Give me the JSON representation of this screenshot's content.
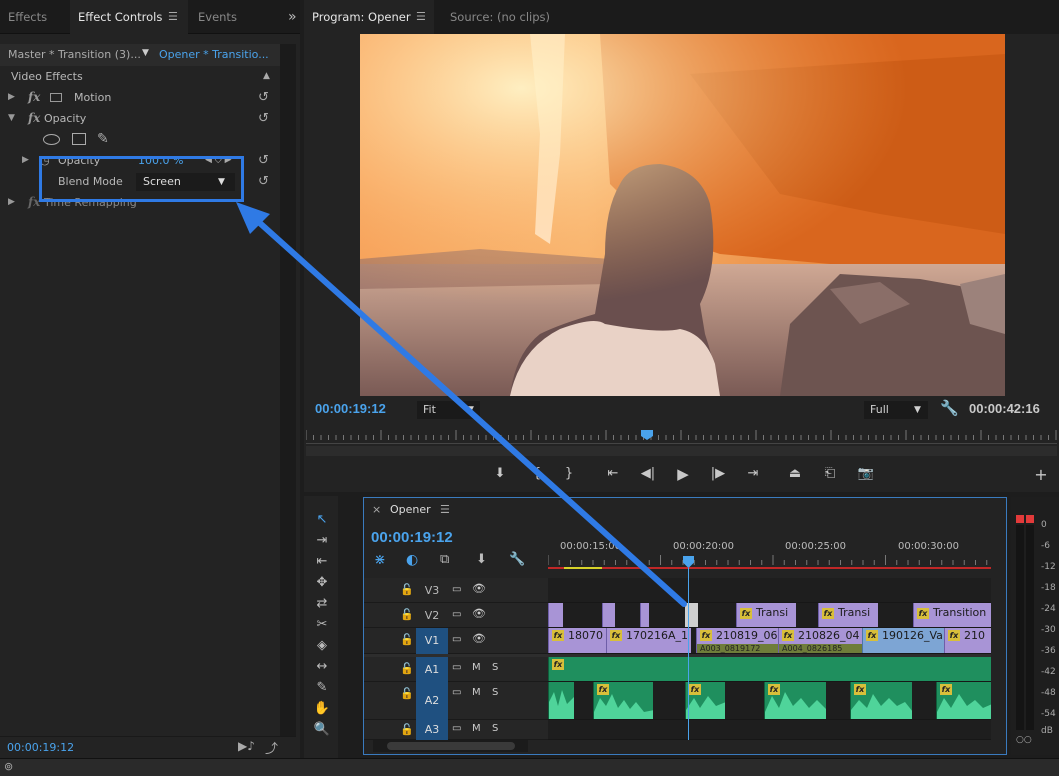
{
  "left_panel": {
    "tabs": [
      "Effects",
      "Effect Controls",
      "Events"
    ],
    "overflow_glyph": "»",
    "header": {
      "master": "Master * Transition (3)...",
      "sequence": "Opener * Transitio..."
    },
    "section_title": "Video Effects",
    "effects": {
      "motion": "Motion",
      "opacity": "Opacity",
      "opacity_param": "Opacity",
      "opacity_value": "100.0 %",
      "blend_mode_label": "Blend Mode",
      "blend_mode_value": "Screen",
      "time_remapping": "Time Remapping"
    },
    "status_timecode": "00:00:19:12"
  },
  "program_monitor": {
    "tabs": [
      "Program: Opener",
      "Source: (no clips)"
    ],
    "timecode_current": "00:00:19:12",
    "fit_value": "Fit",
    "quality_value": "Full",
    "timecode_duration": "00:00:42:16"
  },
  "timeline": {
    "sequence_name": "Opener",
    "timecode": "00:00:19:12",
    "ruler_labels": [
      "00:00:15:00",
      "00:00:20:00",
      "00:00:25:00",
      "00:00:30:00"
    ],
    "tracks": [
      "V3",
      "V2",
      "V1",
      "A1",
      "A2",
      "A3"
    ],
    "mute_label": "M",
    "solo_label": "S",
    "v2_clips": [
      "Transi",
      "Transi",
      "Transition"
    ],
    "v1_clips": [
      "18070",
      "170216A_1",
      "210819_06",
      "210826_04",
      "190126_Va",
      "210"
    ],
    "v1_sublabels": [
      "A003_0819172",
      "A004_0826185"
    ]
  },
  "meters": {
    "scale": [
      "0",
      "-6",
      "-12",
      "-18",
      "-24",
      "-30",
      "-36",
      "-42",
      "-48",
      "-54",
      "dB"
    ]
  },
  "colors": {
    "accent_blue": "#4aa3ec",
    "annotation_blue": "#2f7ae5",
    "video_clip": "#a894d6",
    "audio_clip": "#1f8f5e"
  }
}
